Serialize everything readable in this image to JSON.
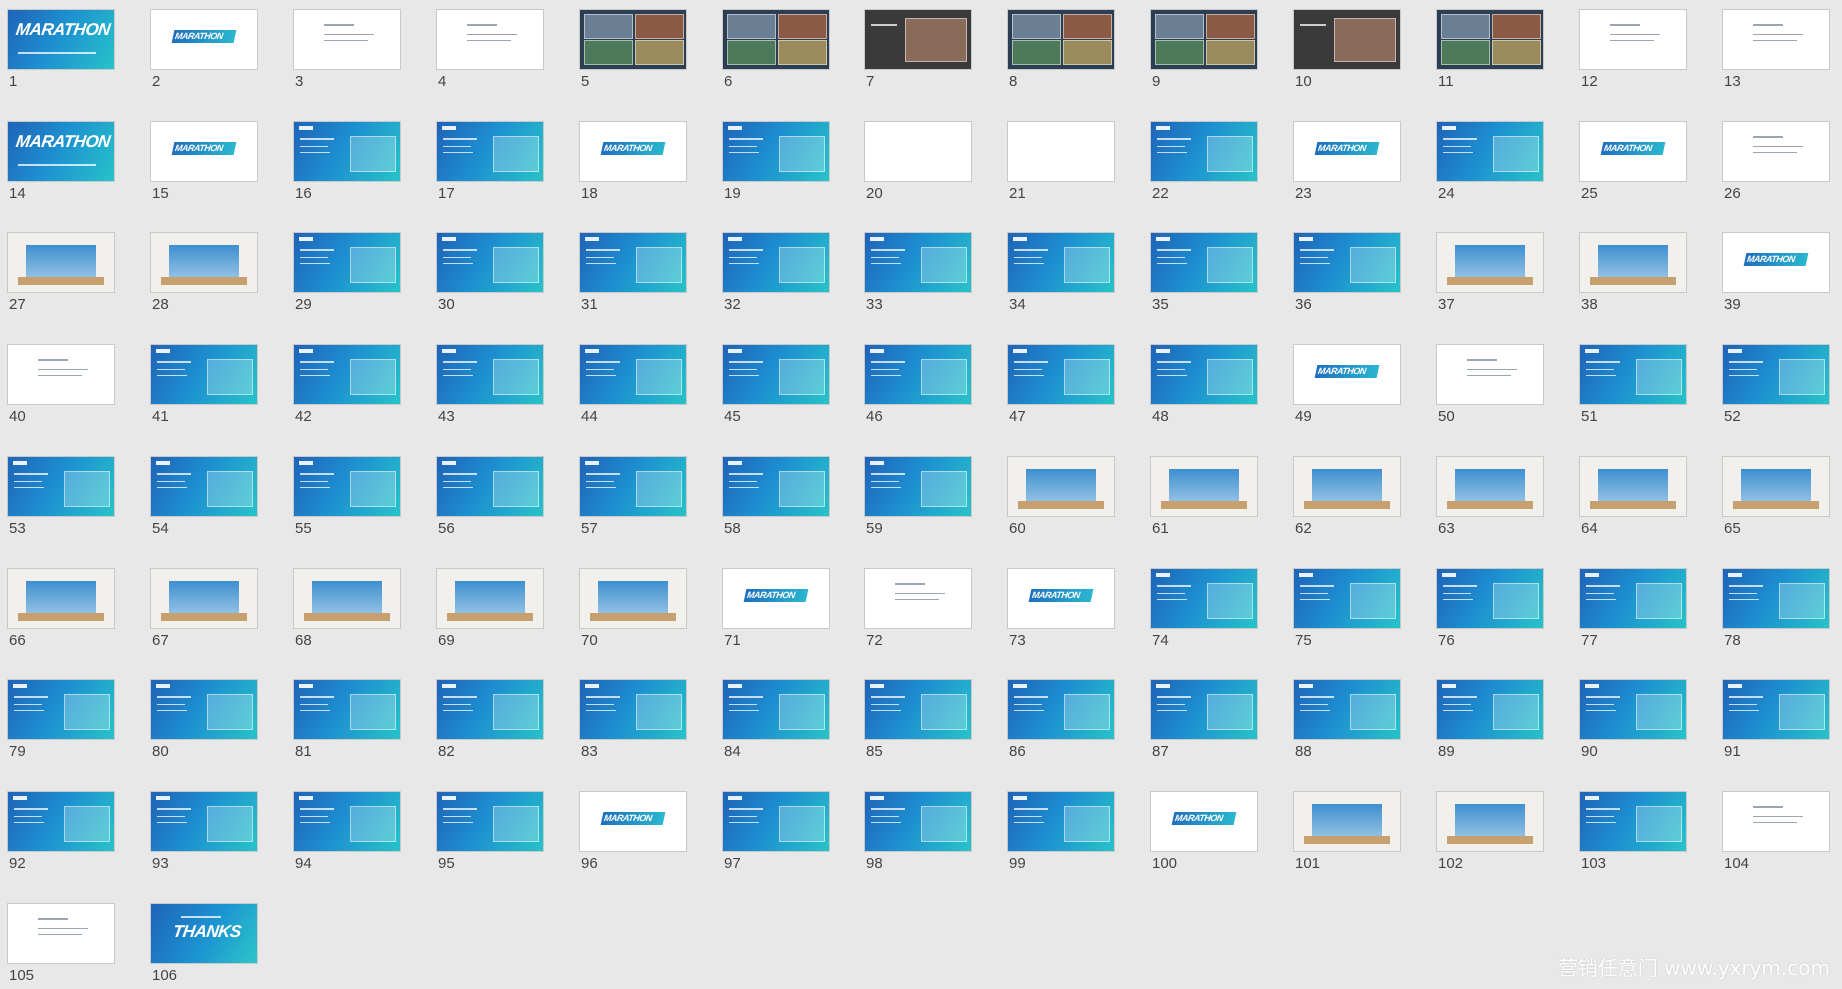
{
  "view": "slide-sorter",
  "watermark": "营销任意门 www.yxrym.com",
  "slide_title_text": {
    "marathon": "MARATHON",
    "thanks": "THANKS"
  },
  "slides": [
    {
      "n": "1",
      "kind": "title"
    },
    {
      "n": "2",
      "kind": "section"
    },
    {
      "n": "3",
      "kind": "white"
    },
    {
      "n": "4",
      "kind": "white"
    },
    {
      "n": "5",
      "kind": "photo"
    },
    {
      "n": "6",
      "kind": "photo"
    },
    {
      "n": "7",
      "kind": "dark"
    },
    {
      "n": "8",
      "kind": "photo"
    },
    {
      "n": "9",
      "kind": "photo"
    },
    {
      "n": "10",
      "kind": "dark"
    },
    {
      "n": "11",
      "kind": "photo"
    },
    {
      "n": "12",
      "kind": "white"
    },
    {
      "n": "13",
      "kind": "white"
    },
    {
      "n": "14",
      "kind": "title"
    },
    {
      "n": "15",
      "kind": "section"
    },
    {
      "n": "16",
      "kind": "blue"
    },
    {
      "n": "17",
      "kind": "blue"
    },
    {
      "n": "18",
      "kind": "section"
    },
    {
      "n": "19",
      "kind": "blue"
    },
    {
      "n": "20",
      "kind": "blank"
    },
    {
      "n": "21",
      "kind": "blank"
    },
    {
      "n": "22",
      "kind": "blue"
    },
    {
      "n": "23",
      "kind": "section"
    },
    {
      "n": "24",
      "kind": "blue"
    },
    {
      "n": "25",
      "kind": "section"
    },
    {
      "n": "26",
      "kind": "white"
    },
    {
      "n": "27",
      "kind": "render"
    },
    {
      "n": "28",
      "kind": "render"
    },
    {
      "n": "29",
      "kind": "blue"
    },
    {
      "n": "30",
      "kind": "blue"
    },
    {
      "n": "31",
      "kind": "blue"
    },
    {
      "n": "32",
      "kind": "blue"
    },
    {
      "n": "33",
      "kind": "blue"
    },
    {
      "n": "34",
      "kind": "blue"
    },
    {
      "n": "35",
      "kind": "blue"
    },
    {
      "n": "36",
      "kind": "blue"
    },
    {
      "n": "37",
      "kind": "render"
    },
    {
      "n": "38",
      "kind": "render"
    },
    {
      "n": "39",
      "kind": "section"
    },
    {
      "n": "40",
      "kind": "white"
    },
    {
      "n": "41",
      "kind": "blue"
    },
    {
      "n": "42",
      "kind": "blue"
    },
    {
      "n": "43",
      "kind": "blue"
    },
    {
      "n": "44",
      "kind": "blue"
    },
    {
      "n": "45",
      "kind": "blue"
    },
    {
      "n": "46",
      "kind": "blue"
    },
    {
      "n": "47",
      "kind": "blue"
    },
    {
      "n": "48",
      "kind": "blue"
    },
    {
      "n": "49",
      "kind": "section"
    },
    {
      "n": "50",
      "kind": "white"
    },
    {
      "n": "51",
      "kind": "blue"
    },
    {
      "n": "52",
      "kind": "blue"
    },
    {
      "n": "53",
      "kind": "blue"
    },
    {
      "n": "54",
      "kind": "blue"
    },
    {
      "n": "55",
      "kind": "blue"
    },
    {
      "n": "56",
      "kind": "blue"
    },
    {
      "n": "57",
      "kind": "blue"
    },
    {
      "n": "58",
      "kind": "blue"
    },
    {
      "n": "59",
      "kind": "blue"
    },
    {
      "n": "60",
      "kind": "render"
    },
    {
      "n": "61",
      "kind": "render"
    },
    {
      "n": "62",
      "kind": "render"
    },
    {
      "n": "63",
      "kind": "render"
    },
    {
      "n": "64",
      "kind": "render"
    },
    {
      "n": "65",
      "kind": "render"
    },
    {
      "n": "66",
      "kind": "render"
    },
    {
      "n": "67",
      "kind": "render"
    },
    {
      "n": "68",
      "kind": "render"
    },
    {
      "n": "69",
      "kind": "render"
    },
    {
      "n": "70",
      "kind": "render"
    },
    {
      "n": "71",
      "kind": "section"
    },
    {
      "n": "72",
      "kind": "white"
    },
    {
      "n": "73",
      "kind": "section"
    },
    {
      "n": "74",
      "kind": "blue"
    },
    {
      "n": "75",
      "kind": "blue"
    },
    {
      "n": "76",
      "kind": "blue"
    },
    {
      "n": "77",
      "kind": "blue"
    },
    {
      "n": "78",
      "kind": "blue"
    },
    {
      "n": "79",
      "kind": "blue"
    },
    {
      "n": "80",
      "kind": "blue"
    },
    {
      "n": "81",
      "kind": "blue"
    },
    {
      "n": "82",
      "kind": "blue"
    },
    {
      "n": "83",
      "kind": "blue"
    },
    {
      "n": "84",
      "kind": "blue"
    },
    {
      "n": "85",
      "kind": "blue"
    },
    {
      "n": "86",
      "kind": "blue"
    },
    {
      "n": "87",
      "kind": "blue"
    },
    {
      "n": "88",
      "kind": "blue"
    },
    {
      "n": "89",
      "kind": "blue"
    },
    {
      "n": "90",
      "kind": "blue"
    },
    {
      "n": "91",
      "kind": "blue"
    },
    {
      "n": "92",
      "kind": "blue"
    },
    {
      "n": "93",
      "kind": "blue"
    },
    {
      "n": "94",
      "kind": "blue"
    },
    {
      "n": "95",
      "kind": "blue"
    },
    {
      "n": "96",
      "kind": "section"
    },
    {
      "n": "97",
      "kind": "blue"
    },
    {
      "n": "98",
      "kind": "blue"
    },
    {
      "n": "99",
      "kind": "blue"
    },
    {
      "n": "100",
      "kind": "section"
    },
    {
      "n": "101",
      "kind": "render"
    },
    {
      "n": "102",
      "kind": "render"
    },
    {
      "n": "103",
      "kind": "blue"
    },
    {
      "n": "104",
      "kind": "white"
    },
    {
      "n": "105",
      "kind": "white"
    },
    {
      "n": "106",
      "kind": "thanks"
    }
  ],
  "colors": {
    "background": "#e8e8e8",
    "accent_blue": "#1f63b8",
    "accent_teal": "#27c3c9",
    "number_text": "#444444"
  }
}
